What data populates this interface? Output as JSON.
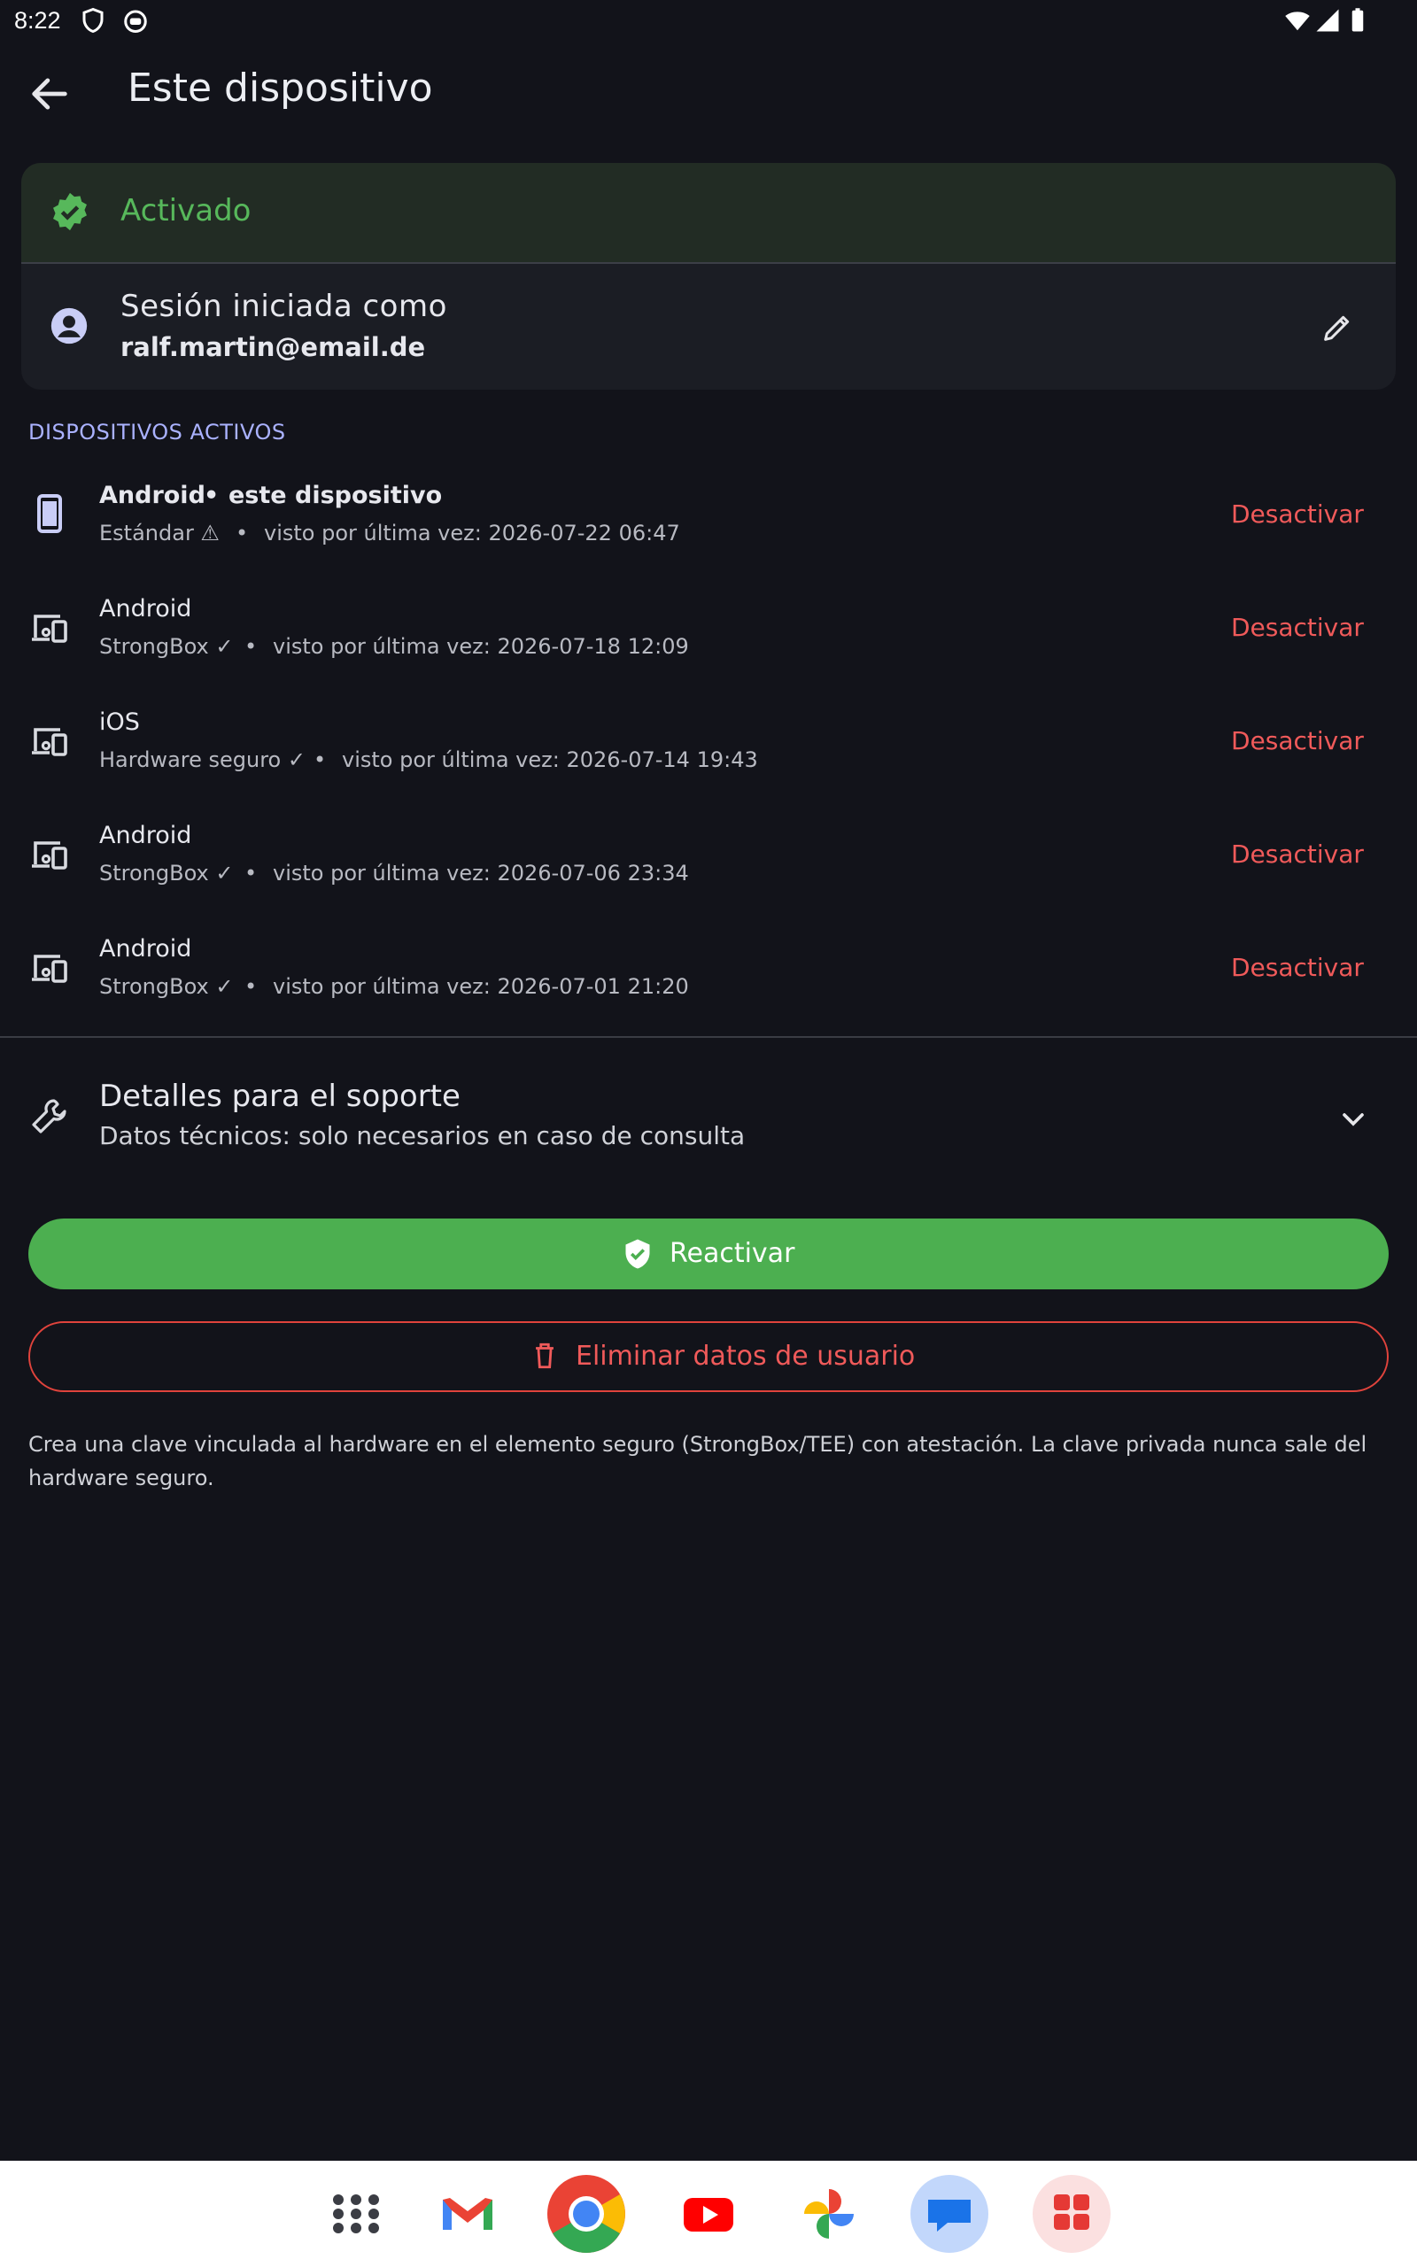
{
  "status_bar": {
    "time": "8:22"
  },
  "app_bar": {
    "title": "Este dispositivo"
  },
  "status_card": {
    "status": "Activado",
    "session_label": "Sesión iniciada como",
    "email": "ralf.martin@email.de"
  },
  "devices": {
    "header": "DISPOSITIVOS ACTIVOS",
    "items": [
      {
        "name": "Android",
        "this_device": "este dispositivo",
        "security": "Estándar ⚠",
        "last_seen": "visto por última vez: 2026-07-22 06:47",
        "action": "Desactivar"
      },
      {
        "name": "Android",
        "security": "StrongBox ✓",
        "last_seen": "visto por última vez: 2026-07-18 12:09",
        "action": "Desactivar"
      },
      {
        "name": "iOS",
        "security": "Hardware seguro ✓",
        "last_seen": "visto por última vez: 2026-07-14 19:43",
        "action": "Desactivar"
      },
      {
        "name": "Android",
        "security": "StrongBox ✓",
        "last_seen": "visto por última vez: 2026-07-06 23:34",
        "action": "Desactivar"
      },
      {
        "name": "Android",
        "security": "StrongBox ✓",
        "last_seen": "visto por última vez: 2026-07-01 21:20",
        "action": "Desactivar"
      }
    ],
    "separator": "•"
  },
  "support": {
    "title": "Detalles para el soporte",
    "subtitle": "Datos técnicos: solo necesarios en caso de consulta"
  },
  "buttons": {
    "reactivate": "Reactivar",
    "delete": "Eliminar datos de usuario"
  },
  "footnote": "Crea una clave vinculada al hardware en el elemento seguro (StrongBox/TEE) con atestación. La clave privada nunca sale del hardware seguro.",
  "dock": {
    "apps": [
      "app-drawer-icon",
      "gmail-icon",
      "chrome-icon",
      "youtube-icon",
      "photos-icon",
      "messages-icon",
      "play-store-icon"
    ]
  },
  "colors": {
    "accent_green": "#4caf50",
    "danger": "#f05a5a",
    "section": "#aab2ff",
    "background": "#12131a"
  }
}
